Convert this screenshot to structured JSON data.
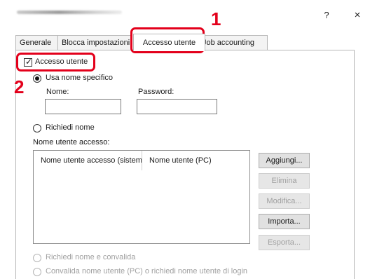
{
  "window": {
    "help_label": "?",
    "close_label": "×"
  },
  "tabs": [
    {
      "label": "Generale"
    },
    {
      "label": "Blocca impostazioni"
    },
    {
      "label": "Accesso utente"
    },
    {
      "label": "Job accounting"
    }
  ],
  "active_tab": "Accesso utente",
  "panel": {
    "user_login_checkbox": {
      "label": "Accesso utente",
      "checked": true
    },
    "use_specific_name": {
      "label": "Usa nome specifico",
      "selected": true
    },
    "name_field": {
      "label": "Nome:",
      "value": ""
    },
    "password_field": {
      "label": "Password:",
      "value": ""
    },
    "prompt_for_name": {
      "label": "Richiedi nome",
      "selected": false
    },
    "login_user_list": {
      "label": "Nome utente accesso:",
      "columns": [
        "Nome utente accesso (sistema)",
        "Nome utente (PC)"
      ],
      "rows": []
    },
    "buttons": {
      "add": "Aggiungi...",
      "delete": "Elimina",
      "edit": "Modifica...",
      "import": "Importa...",
      "export": "Esporta..."
    },
    "prompt_name_and_validate": {
      "label": "Richiedi nome e convalida",
      "enabled": false
    },
    "validate_pc_name": {
      "label": "Convalida nome utente (PC) o richiedi nome utente di login",
      "enabled": false
    }
  },
  "annotations": {
    "step1": "1",
    "step2": "2"
  },
  "colors": {
    "callout": "#e3001b",
    "border": "#b8b8b8",
    "disabled_text": "#a0a0a0"
  }
}
